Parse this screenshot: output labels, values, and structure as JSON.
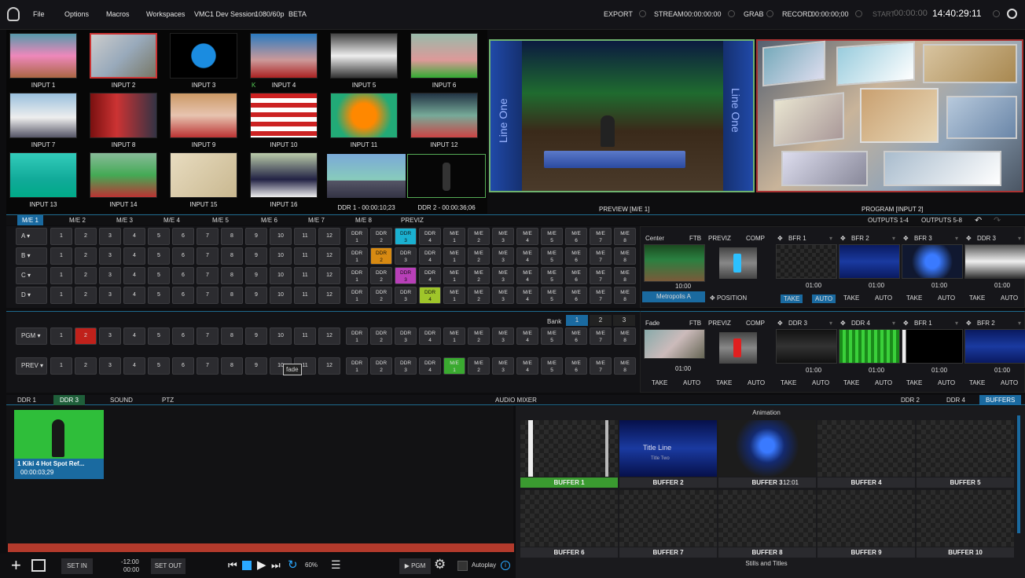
{
  "menu": {
    "file": "File",
    "options": "Options",
    "macros": "Macros",
    "workspaces": "Workspaces",
    "session": "VMC1 Dev Session",
    "format": "1080/60p",
    "beta": "BETA"
  },
  "status": {
    "export": "EXPORT",
    "stream": "STREAM",
    "stream_time": "00:00:00:00",
    "grab": "GRAB",
    "record": "RECORD",
    "record_time": "00:00:00;00",
    "start": "START",
    "start_time": "00:00:00",
    "clock": "14:40:29:11"
  },
  "inputs": [
    "INPUT 1",
    "INPUT 2",
    "INPUT 3",
    "INPUT 4",
    "INPUT 5",
    "INPUT 6",
    "INPUT 7",
    "INPUT 8",
    "INPUT 9",
    "INPUT 10",
    "INPUT 11",
    "INPUT 12",
    "INPUT 13",
    "INPUT 14",
    "INPUT 15",
    "INPUT 16"
  ],
  "k_marker": "K",
  "ddr1_label": "DDR 1 - 00:00:10;23",
  "ddr2_label": "DDR 2 - 00:00:36;06",
  "preview_label": "PREVIEW [M/E 1]",
  "program_label": "PROGRAM [INPUT 2]",
  "set_text": "Line One",
  "me_tabs": [
    "M/E 1",
    "M/E 2",
    "M/E 3",
    "M/E 4",
    "M/E 5",
    "M/E 6",
    "M/E 7",
    "M/E 8",
    "PREVIZ"
  ],
  "outputs": [
    "OUTPUTS 1-4",
    "OUTPUTS 5-8"
  ],
  "row_labels": [
    "A",
    "B",
    "C",
    "D"
  ],
  "nums": [
    "1",
    "2",
    "3",
    "4",
    "5",
    "6",
    "7",
    "8",
    "9",
    "10",
    "11",
    "12"
  ],
  "ddr_btns": [
    [
      "DDR",
      "1"
    ],
    [
      "DDR",
      "2"
    ],
    [
      "DDR",
      "3"
    ],
    [
      "DDR",
      "4"
    ]
  ],
  "me_btns": [
    [
      "M/E",
      "1"
    ],
    [
      "M/E",
      "2"
    ],
    [
      "M/E",
      "3"
    ],
    [
      "M/E",
      "4"
    ],
    [
      "M/E",
      "5"
    ],
    [
      "M/E",
      "6"
    ],
    [
      "M/E",
      "7"
    ],
    [
      "M/E",
      "8"
    ]
  ],
  "me_panel": {
    "mode": "Center",
    "ftb": "FTB",
    "previz": "PREVIZ",
    "comp": "COMP",
    "duration": "10:00",
    "preset": "Metropolis A",
    "position": "POSITION"
  },
  "bfr_top": [
    {
      "name": "BFR 1",
      "time": "01:00"
    },
    {
      "name": "BFR 2",
      "time": "01:00"
    },
    {
      "name": "BFR 3",
      "time": "01:00"
    },
    {
      "name": "DDR 3",
      "time": "01:00"
    }
  ],
  "take": "TAKE",
  "auto": "AUTO",
  "bank": {
    "label": "Bank",
    "values": [
      "1",
      "2",
      "3"
    ]
  },
  "pgm_label": "PGM",
  "prev_label": "PREV",
  "fade_tip": "fade",
  "main_panel": {
    "mode": "Fade",
    "ftb": "FTB",
    "previz": "PREVIZ",
    "comp": "COMP",
    "duration": "01:00"
  },
  "bfr_bottom": [
    {
      "name": "DDR 3",
      "time": "01:00"
    },
    {
      "name": "DDR 4",
      "time": "01:00"
    },
    {
      "name": "BFR 1",
      "time": "01:00"
    },
    {
      "name": "BFR 2",
      "time": "01:00"
    }
  ],
  "bottom_tabs": [
    "DDR 1",
    "DDR 3",
    "SOUND",
    "PTZ"
  ],
  "audio_mixer": "AUDIO MIXER",
  "right_tabs": [
    "DDR 2",
    "DDR 4",
    "BUFFERS"
  ],
  "clip": {
    "title": "1 Kiki 4 Hot Spot Ref...",
    "time": "00:00:03;29"
  },
  "transport": {
    "set_in": "SET IN",
    "time_top": "-12:00",
    "time_bottom": "00:00",
    "set_out": "SET OUT",
    "speed": "60%",
    "to_pgm": "PGM",
    "autoplay": "Autoplay"
  },
  "buffers": {
    "animation": "Animation",
    "stills": "Stills and Titles",
    "time": "12:01",
    "names": [
      "BUFFER 1",
      "BUFFER 2",
      "BUFFER 3",
      "BUFFER 4",
      "BUFFER 5",
      "BUFFER 6",
      "BUFFER 7",
      "BUFFER 8",
      "BUFFER 9",
      "BUFFER 10"
    ]
  },
  "title_card": {
    "line1": "Title Line",
    "line2": "Title Two"
  },
  "colors": {
    "accent": "#1a6aa0",
    "pgm_red": "#c0211b",
    "ddr_orange": "#d88a12",
    "ddr_cyan": "#1ab0d0",
    "ddr_magenta": "#b83fb8",
    "ddr_lime": "#9fc52a",
    "me_green": "#3aaa30"
  }
}
